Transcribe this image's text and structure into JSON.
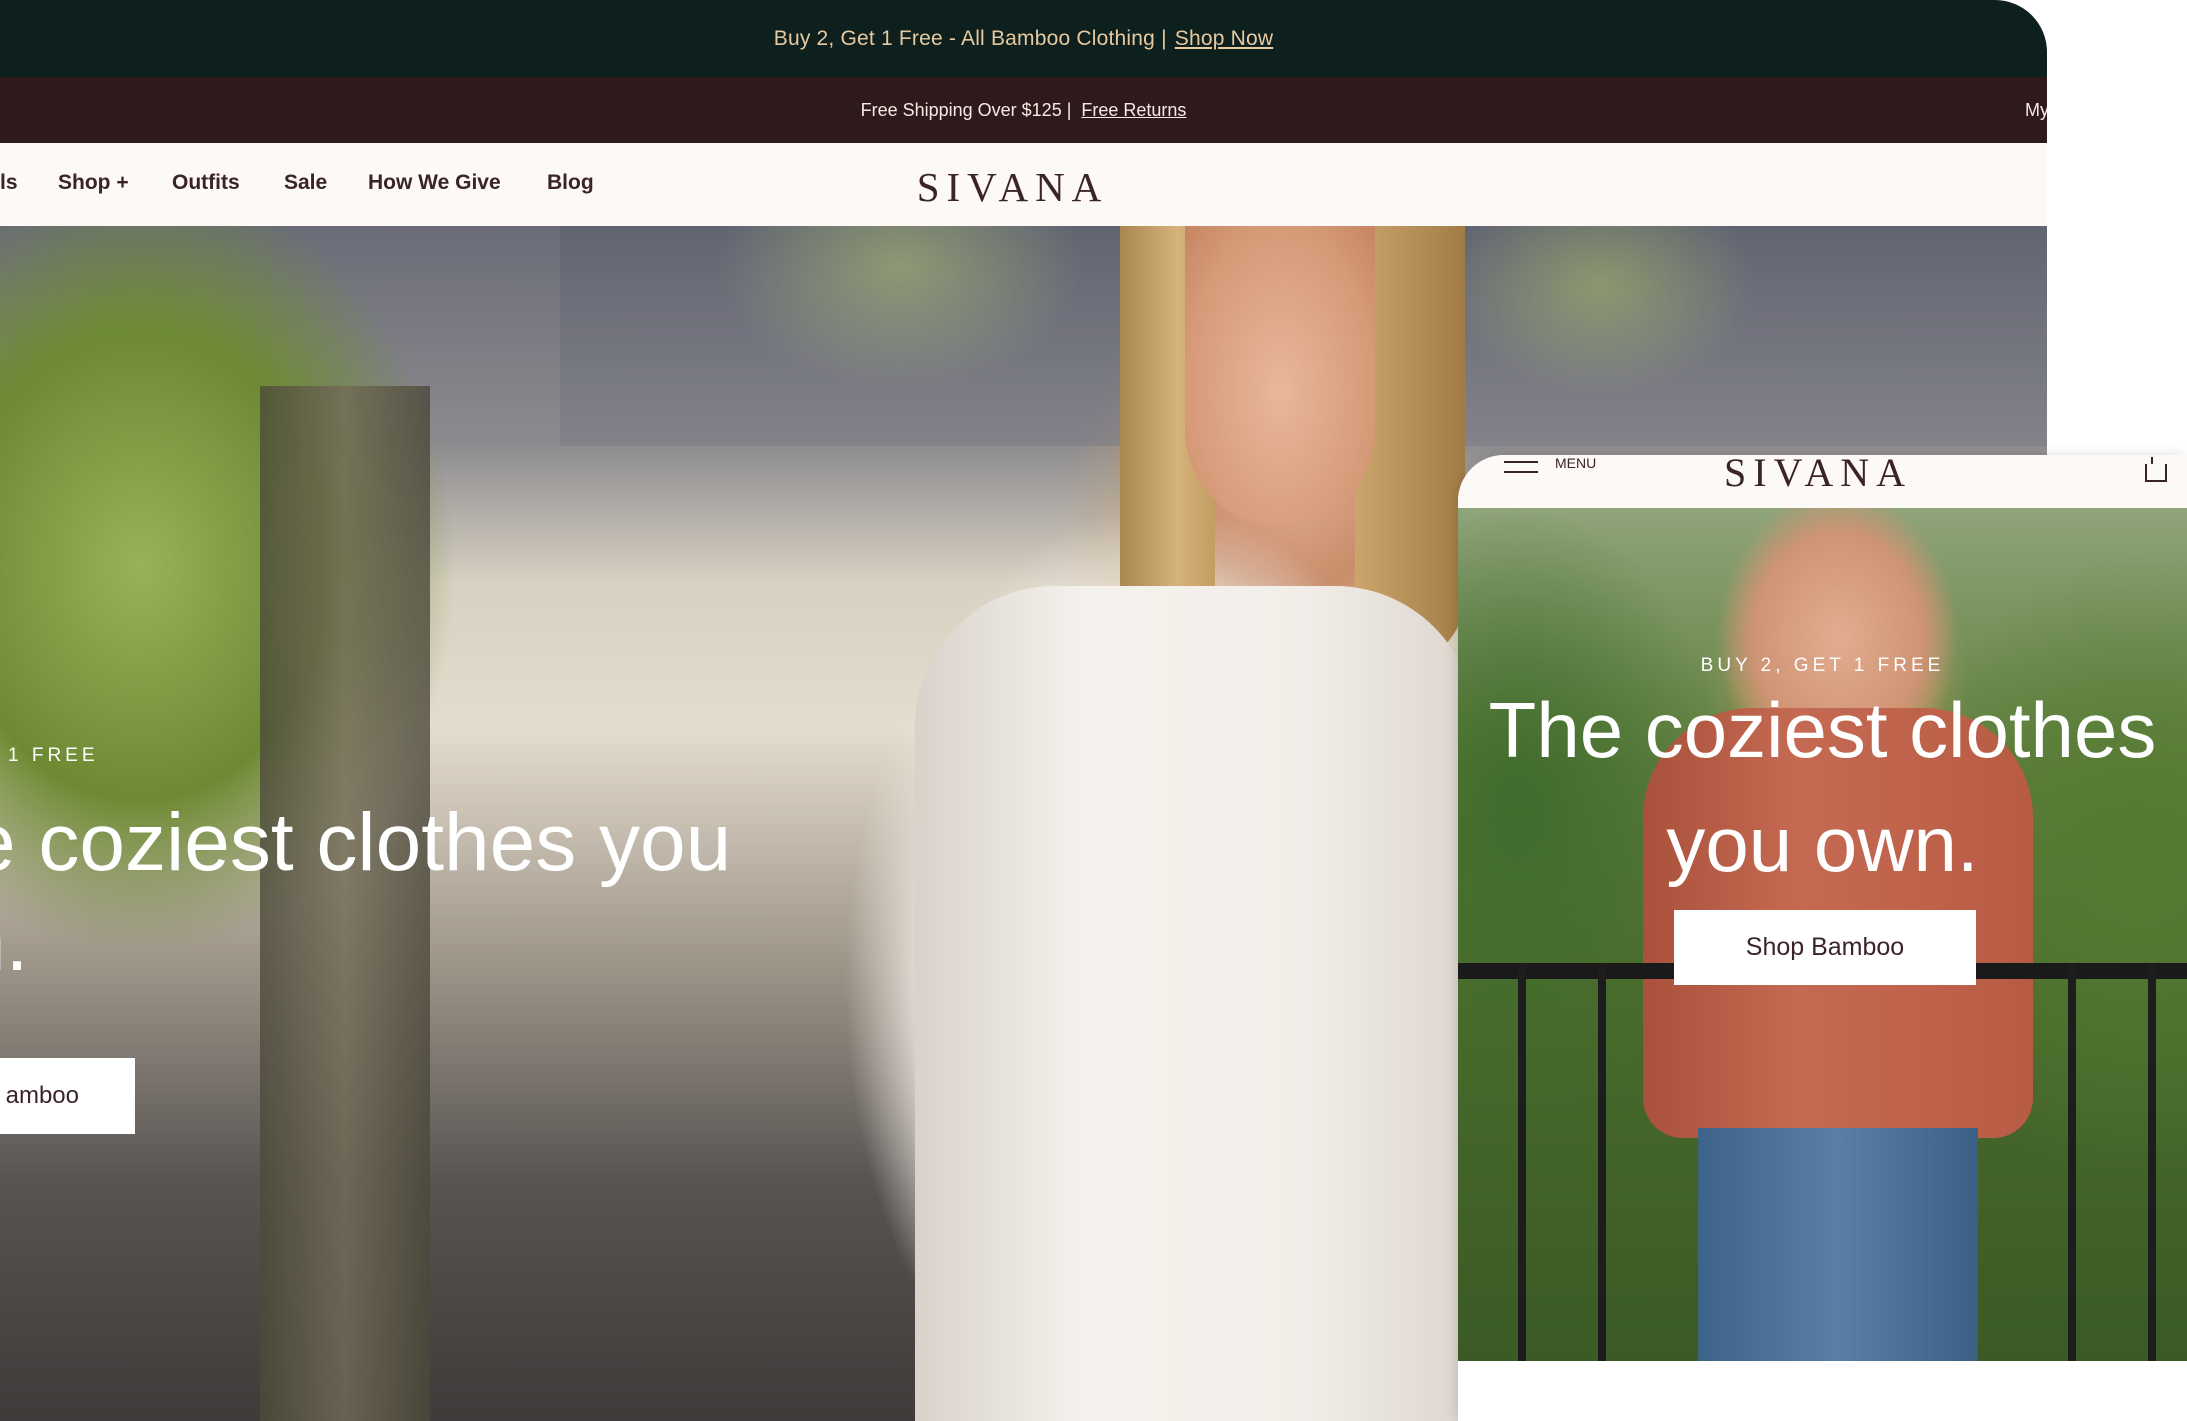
{
  "desktop": {
    "promo": {
      "text": "Buy 2, Get 1 Free - All Bamboo Clothing |",
      "link": "Shop Now"
    },
    "shipping": {
      "text": "Free Shipping Over $125 |",
      "link": "Free Returns",
      "account_partial": "My"
    },
    "nav": {
      "items": [
        "ls",
        "Shop +",
        "Outfits",
        "Sale",
        "How We Give",
        "Blog"
      ],
      "logo": "SIVANA"
    },
    "hero": {
      "eyebrow": "1 FREE",
      "headline_line1": "e coziest clothes you",
      "headline_line2": "n.",
      "cta": "amboo"
    }
  },
  "mobile": {
    "header": {
      "menu_label": "MENU",
      "logo": "SIVANA",
      "menu_icon": "hamburger-icon",
      "cart_icon": "shopping-bag-icon"
    },
    "hero": {
      "eyebrow": "BUY 2, GET 1 FREE",
      "headline_line1": "The coziest clothes",
      "headline_line2": "you own.",
      "cta": "Shop Bamboo"
    }
  },
  "colors": {
    "promo_bg": "#0d201e",
    "promo_text": "#e7c9a0",
    "shipping_bg": "#2e1a1c",
    "brand_text": "#3b2427",
    "nav_bg": "#fdf9f6"
  }
}
